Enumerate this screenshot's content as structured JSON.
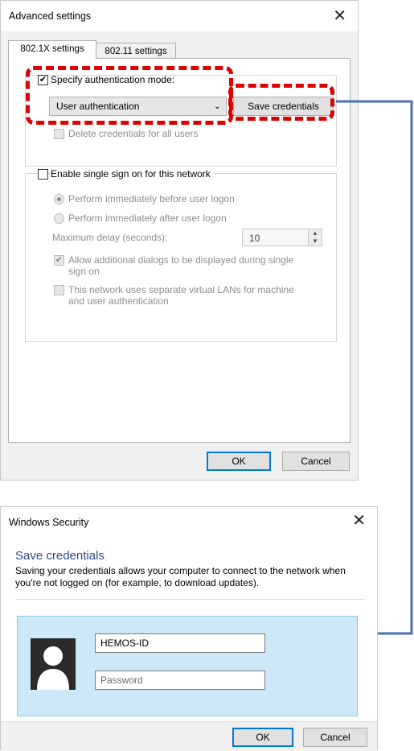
{
  "advanced": {
    "title": "Advanced settings",
    "close": "✕",
    "tabs": [
      "802.1X settings",
      "802.11 settings"
    ],
    "specify_mode_label": "Specify authentication mode:",
    "auth_mode_value": "User authentication",
    "save_credentials": "Save credentials",
    "delete_credentials": "Delete credentials for all users",
    "sso_label": "Enable single sign on for this network",
    "radio_before": "Perform immediately before user logon",
    "radio_after": "Perform immediately after user logon",
    "max_delay_label": "Maximum delay (seconds):",
    "max_delay_value": "10",
    "allow_dialogs": "Allow additional dialogs to be displayed during single sign on",
    "allow_dialogs_line1": "Allow additional dialogs to be displayed during single",
    "allow_dialogs_line2": "sign on",
    "separate_vlans_line1": "This network uses separate virtual LANs for machine",
    "separate_vlans_line2": "and user authentication",
    "ok": "OK",
    "cancel": "Cancel"
  },
  "security": {
    "title": "Windows Security",
    "close": "✕",
    "heading": "Save credentials",
    "description": "Saving your credentials allows your computer to connect to the network when you're not logged on (for example, to download updates).",
    "username_value": "HEMOS-ID",
    "password_placeholder": "Password",
    "ok": "OK",
    "cancel": "Cancel"
  },
  "colors": {
    "highlight_dash": "#e00000",
    "arrow": "#4a72b0",
    "cred_panel": "#cde8f6"
  }
}
